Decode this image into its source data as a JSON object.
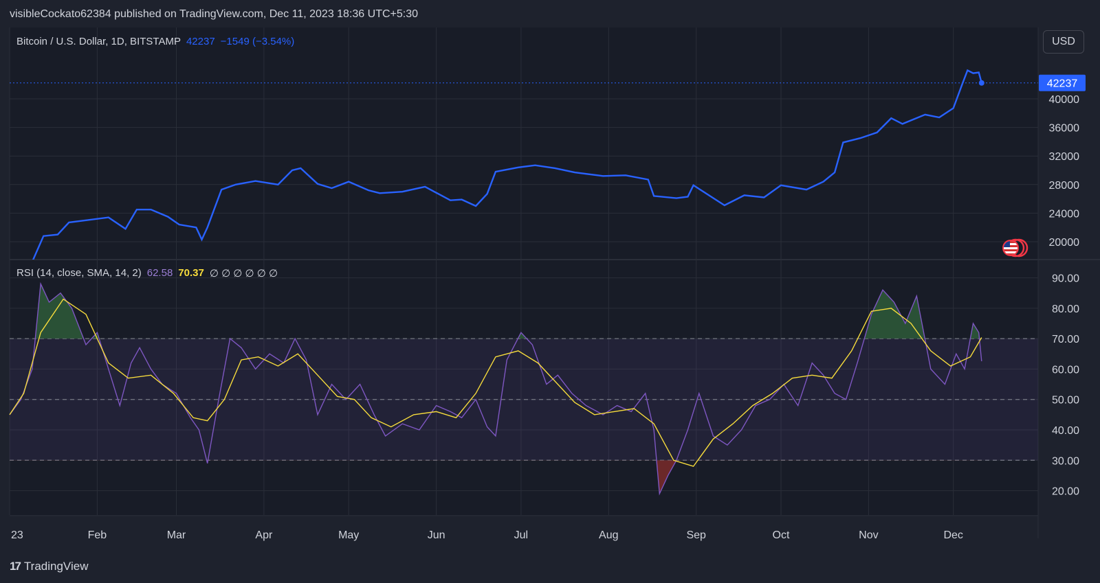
{
  "header": {
    "published": "visibleCockato62384 published on TradingView.com, Dec 11, 2023 18:36 UTC+5:30"
  },
  "footer": {
    "brand": "TradingView",
    "logo_text": "17"
  },
  "price_legend": {
    "symbol": "Bitcoin / U.S. Dollar, 1D, BITSTAMP",
    "last": "42237",
    "change": "−1549 (−3.54%)"
  },
  "rsi_legend": {
    "label": "RSI (14, close, SMA, 14, 2)",
    "rsi": "62.58",
    "ma": "70.37",
    "empties": "∅ ∅ ∅ ∅ ∅ ∅"
  },
  "currency_button": "USD",
  "flag_icon": "us-flag-icon",
  "colors": {
    "background": "#1e222d",
    "price_line": "#2962ff",
    "rsi_line": "#7e57c2",
    "rsi_ma": "#f7dc3c",
    "grid": "#2a2e39",
    "overbought_fill": "#2e5a3a",
    "oversold_fill": "#7a2a2a"
  },
  "chart_data": [
    {
      "type": "line",
      "title": "Bitcoin / U.S. Dollar, 1D, BITSTAMP",
      "ylim": [
        17500,
        50000
      ],
      "ytick_labels": [
        "20000",
        "24000",
        "28000",
        "32000",
        "36000",
        "40000"
      ],
      "last_price_label": "42237",
      "xtick_labels": [
        "23",
        "Feb",
        "Mar",
        "Apr",
        "May",
        "Jun",
        "Jul",
        "Aug",
        "Sep",
        "Oct",
        "Nov",
        "Dec"
      ],
      "series": [
        {
          "x": [
            "2023-01-09",
            "2023-01-13",
            "2023-01-18",
            "2023-01-22",
            "2023-01-28",
            "2023-02-05",
            "2023-02-11",
            "2023-02-15",
            "2023-02-20",
            "2023-02-26",
            "2023-03-02",
            "2023-03-08",
            "2023-03-10",
            "2023-03-12",
            "2023-03-17",
            "2023-03-22",
            "2023-03-29",
            "2023-04-06",
            "2023-04-11",
            "2023-04-14",
            "2023-04-20",
            "2023-04-25",
            "2023-05-01",
            "2023-05-08",
            "2023-05-12",
            "2023-05-20",
            "2023-05-28",
            "2023-06-06",
            "2023-06-10",
            "2023-06-15",
            "2023-06-19",
            "2023-06-22",
            "2023-06-30",
            "2023-07-06",
            "2023-07-13",
            "2023-07-20",
            "2023-07-30",
            "2023-08-07",
            "2023-08-15",
            "2023-08-17",
            "2023-08-25",
            "2023-08-29",
            "2023-08-31",
            "2023-09-11",
            "2023-09-18",
            "2023-09-25",
            "2023-10-01",
            "2023-10-10",
            "2023-10-16",
            "2023-10-20",
            "2023-10-23",
            "2023-10-29",
            "2023-11-04",
            "2023-11-09",
            "2023-11-13",
            "2023-11-21",
            "2023-11-26",
            "2023-12-01",
            "2023-12-04",
            "2023-12-06",
            "2023-12-08",
            "2023-12-10",
            "2023-12-11"
          ],
          "values": [
            17200,
            20800,
            21000,
            22700,
            23000,
            23400,
            21800,
            24500,
            24500,
            23500,
            22400,
            22000,
            20300,
            22000,
            27300,
            28000,
            28500,
            28000,
            30000,
            30300,
            28100,
            27500,
            28400,
            27200,
            26800,
            27000,
            27700,
            25800,
            25900,
            25000,
            26700,
            29800,
            30400,
            30700,
            30300,
            29700,
            29200,
            29300,
            28700,
            26400,
            26100,
            26300,
            27900,
            25100,
            26500,
            26200,
            27900,
            27300,
            28400,
            29700,
            33900,
            34500,
            35300,
            37300,
            36500,
            37800,
            37400,
            38700,
            41900,
            44000,
            43600,
            43700,
            42237
          ]
        }
      ]
    },
    {
      "type": "line",
      "title": "RSI (14, close, SMA, 14, 2)",
      "ylim": [
        12,
        96
      ],
      "ytick_labels": [
        "20.00",
        "30.00",
        "40.00",
        "50.00",
        "60.00",
        "70.00",
        "80.00",
        "90.00"
      ],
      "bands": {
        "upper": 70,
        "middle": 50,
        "lower": 30
      },
      "series": [
        {
          "name": "RSI",
          "x": [
            "2023-01-01",
            "2023-01-05",
            "2023-01-09",
            "2023-01-12",
            "2023-01-15",
            "2023-01-19",
            "2023-01-23",
            "2023-01-28",
            "2023-02-01",
            "2023-02-05",
            "2023-02-09",
            "2023-02-13",
            "2023-02-16",
            "2023-02-20",
            "2023-02-24",
            "2023-03-01",
            "2023-03-06",
            "2023-03-09",
            "2023-03-12",
            "2023-03-16",
            "2023-03-20",
            "2023-03-24",
            "2023-03-29",
            "2023-04-03",
            "2023-04-08",
            "2023-04-12",
            "2023-04-16",
            "2023-04-20",
            "2023-04-25",
            "2023-04-30",
            "2023-05-05",
            "2023-05-10",
            "2023-05-14",
            "2023-05-20",
            "2023-05-26",
            "2023-06-01",
            "2023-06-06",
            "2023-06-10",
            "2023-06-15",
            "2023-06-19",
            "2023-06-22",
            "2023-06-26",
            "2023-07-01",
            "2023-07-05",
            "2023-07-10",
            "2023-07-14",
            "2023-07-19",
            "2023-07-24",
            "2023-07-30",
            "2023-08-04",
            "2023-08-09",
            "2023-08-14",
            "2023-08-17",
            "2023-08-19",
            "2023-08-22",
            "2023-08-25",
            "2023-08-29",
            "2023-09-02",
            "2023-09-07",
            "2023-09-12",
            "2023-09-17",
            "2023-09-22",
            "2023-09-27",
            "2023-10-02",
            "2023-10-07",
            "2023-10-12",
            "2023-10-16",
            "2023-10-20",
            "2023-10-24",
            "2023-10-28",
            "2023-11-02",
            "2023-11-06",
            "2023-11-10",
            "2023-11-14",
            "2023-11-18",
            "2023-11-23",
            "2023-11-28",
            "2023-12-02",
            "2023-12-05",
            "2023-12-08",
            "2023-12-10",
            "2023-12-11"
          ],
          "values": [
            45,
            50,
            60,
            88,
            82,
            85,
            80,
            68,
            72,
            60,
            48,
            62,
            67,
            60,
            55,
            52,
            44,
            40,
            29,
            50,
            70,
            67,
            60,
            65,
            62,
            70,
            63,
            45,
            55,
            50,
            55,
            45,
            38,
            42,
            40,
            48,
            46,
            44,
            50,
            41,
            38,
            63,
            72,
            68,
            55,
            58,
            52,
            48,
            45,
            48,
            46,
            52,
            40,
            19,
            25,
            30,
            40,
            52,
            38,
            35,
            40,
            48,
            50,
            55,
            48,
            62,
            58,
            52,
            50,
            62,
            78,
            86,
            82,
            75,
            84,
            60,
            55,
            65,
            60,
            75,
            72,
            62.58
          ]
        },
        {
          "name": "SMA",
          "x": [
            "2023-01-01",
            "2023-01-06",
            "2023-01-12",
            "2023-01-20",
            "2023-01-28",
            "2023-02-05",
            "2023-02-12",
            "2023-02-20",
            "2023-02-28",
            "2023-03-07",
            "2023-03-12",
            "2023-03-18",
            "2023-03-24",
            "2023-03-30",
            "2023-04-06",
            "2023-04-13",
            "2023-04-20",
            "2023-04-27",
            "2023-05-03",
            "2023-05-09",
            "2023-05-16",
            "2023-05-24",
            "2023-06-01",
            "2023-06-08",
            "2023-06-15",
            "2023-06-22",
            "2023-06-30",
            "2023-07-07",
            "2023-07-13",
            "2023-07-20",
            "2023-07-27",
            "2023-08-03",
            "2023-08-10",
            "2023-08-17",
            "2023-08-24",
            "2023-08-31",
            "2023-09-07",
            "2023-09-14",
            "2023-09-21",
            "2023-09-28",
            "2023-10-05",
            "2023-10-12",
            "2023-10-19",
            "2023-10-26",
            "2023-11-02",
            "2023-11-09",
            "2023-11-16",
            "2023-11-23",
            "2023-11-30",
            "2023-12-07",
            "2023-12-11"
          ],
          "values": [
            45,
            52,
            72,
            83,
            78,
            62,
            57,
            58,
            52,
            44,
            43,
            50,
            63,
            64,
            61,
            65,
            58,
            51,
            50,
            44,
            41,
            45,
            46,
            44,
            52,
            64,
            66,
            62,
            56,
            49,
            45,
            46,
            47,
            42,
            30,
            28,
            37,
            42,
            48,
            52,
            57,
            58,
            57,
            66,
            79,
            80,
            75,
            66,
            61,
            64,
            70.37
          ]
        }
      ]
    }
  ]
}
